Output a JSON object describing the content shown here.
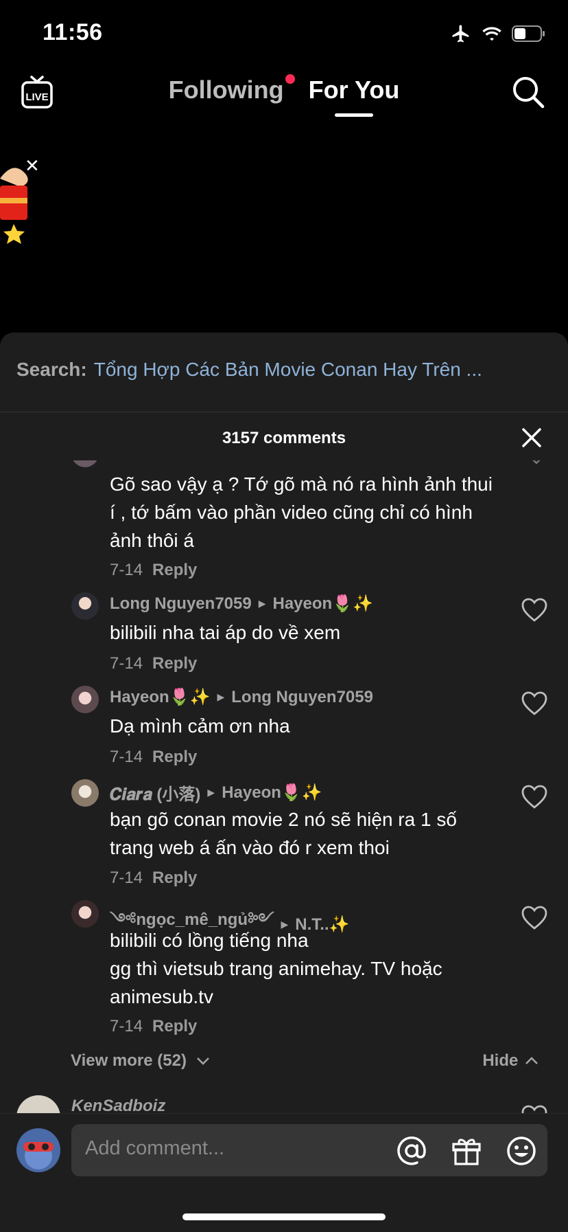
{
  "status_bar": {
    "time": "11:56",
    "airplane_icon": "airplane-icon",
    "wifi_icon": "wifi-icon",
    "battery_icon": "battery-icon"
  },
  "nav": {
    "live_label": "LIVE",
    "tabs": [
      {
        "label": "Following"
      },
      {
        "label": "For You"
      }
    ],
    "active_tab": "For You",
    "search_icon": "search-icon"
  },
  "sheet": {
    "search_label": "Search:",
    "search_query": "Tổng Hợp Các Bản Movie Conan Hay Trên ...",
    "comment_count": "3157 comments",
    "view_more": "View more (52)",
    "hide": "Hide",
    "next_author": "KenSadboiz"
  },
  "comments": [
    {
      "author": "",
      "reply_to": "",
      "text": "Gõ sao vậy ạ ? Tớ gõ mà nó ra hình ảnh thui í , tớ bấm vào phần video cũng chỉ có hình ảnh thôi á",
      "date": "7-14",
      "reply_label": "Reply"
    },
    {
      "author": "Long Nguyen7059",
      "reply_to": "Hayeon🌷✨",
      "text": "bilibili nha tai áp do về xem",
      "date": "7-14",
      "reply_label": "Reply"
    },
    {
      "author": "Hayeon🌷✨",
      "reply_to": "Long Nguyen7059",
      "text": "Dạ mình cảm ơn nha",
      "date": "7-14",
      "reply_label": "Reply"
    },
    {
      "author": "𝑪𝒊𝒂𝒓𝒂 (小落)",
      "reply_to": "Hayeon🌷✨",
      "text": "bạn gõ conan movie 2 nó sẽ hiện ra 1 số trang web á ấn vào đó r xem thoi",
      "date": "7-14",
      "reply_label": "Reply"
    },
    {
      "author": "༺ngọc_mê_ngủ༻",
      "reply_to": "N.T..✨",
      "text": "bilibili có lồng tiếng nha\ngg thì vietsub trang animehay. TV hoặc animesub.tv",
      "date": "7-14",
      "reply_label": "Reply"
    }
  ],
  "composer": {
    "placeholder": "Add comment..."
  },
  "colors": {
    "background": "#000000",
    "sheet": "#1e1e1e",
    "accent_dot": "#fe2c55",
    "query_link": "#8fb3d9"
  }
}
